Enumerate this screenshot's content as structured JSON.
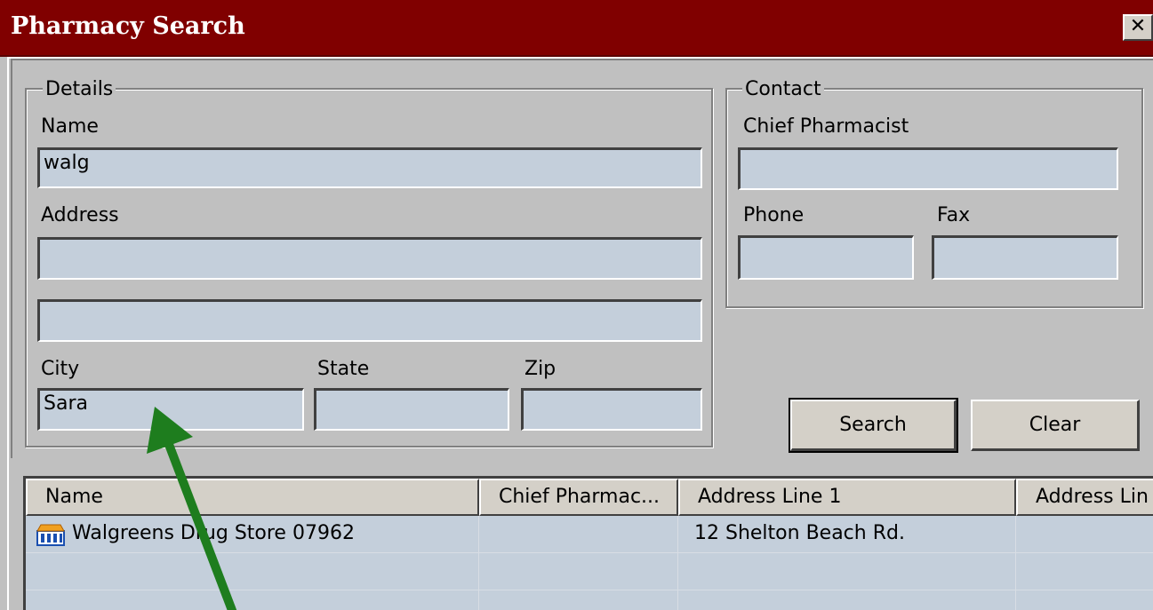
{
  "window": {
    "title": "Pharmacy Search",
    "close_label": "✕"
  },
  "details": {
    "legend": "Details",
    "name_label": "Name",
    "name_value": "walg",
    "address_label": "Address",
    "address1_value": "",
    "address2_value": "",
    "city_label": "City",
    "city_value": "Sara",
    "state_label": "State",
    "state_value": "",
    "zip_label": "Zip",
    "zip_value": ""
  },
  "contact": {
    "legend": "Contact",
    "chief_pharmacist_label": "Chief Pharmacist",
    "chief_pharmacist_value": "",
    "phone_label": "Phone",
    "phone_value": "",
    "fax_label": "Fax",
    "fax_value": ""
  },
  "actions": {
    "search_label": "Search",
    "clear_label": "Clear"
  },
  "results": {
    "columns": [
      "Name",
      "Chief Pharmac...",
      "Address Line 1",
      "Address Lin"
    ],
    "rows": [
      {
        "name": "Walgreens Drug Store 07962",
        "chief_pharmacist": "",
        "address1": "12 Shelton Beach Rd.",
        "address2": "",
        "icon": "store-icon"
      }
    ]
  },
  "annotation": {
    "arrow_color": "#1e7d1e",
    "icon": "arrow-icon"
  },
  "colors": {
    "titlebar": "#800000",
    "field_bg": "#c4cfdb",
    "window_bg": "#c0c0c0"
  }
}
